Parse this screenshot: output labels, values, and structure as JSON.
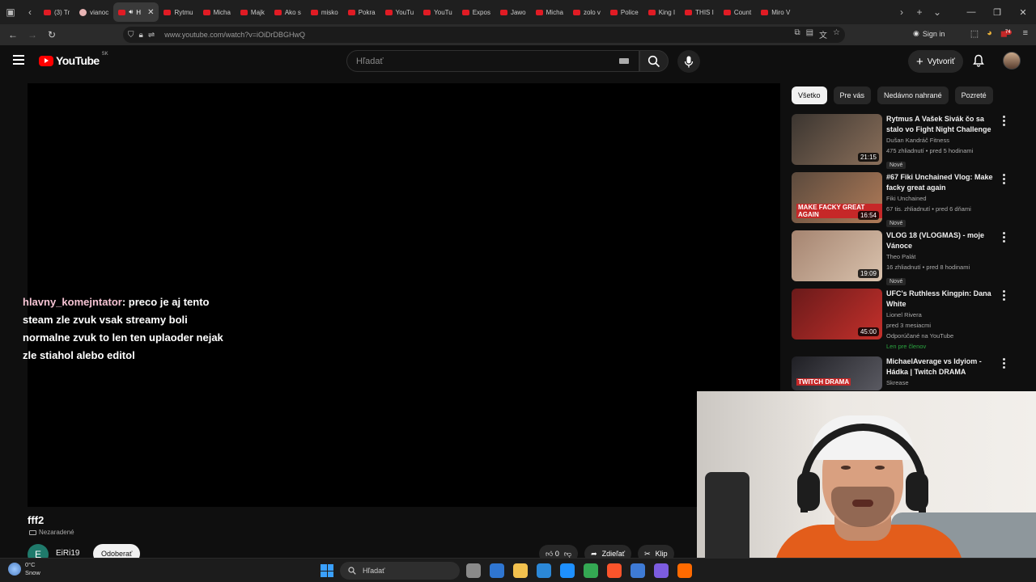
{
  "browser": {
    "tabs": [
      {
        "label": "(3) Tr",
        "color": "#e01b24"
      },
      {
        "label": "vianoc",
        "color": "#e7b3b3"
      },
      {
        "label": "H",
        "color": "#e01b24",
        "active": true
      },
      {
        "label": "Rytmu",
        "color": "#e01b24"
      },
      {
        "label": "Micha",
        "color": "#e01b24"
      },
      {
        "label": "Majk",
        "color": "#e01b24"
      },
      {
        "label": "Ako s",
        "color": "#e01b24"
      },
      {
        "label": "misko",
        "color": "#e01b24"
      },
      {
        "label": "Pokra",
        "color": "#e01b24"
      },
      {
        "label": "YouTu",
        "color": "#e01b24"
      },
      {
        "label": "YouTu",
        "color": "#e01b24"
      },
      {
        "label": "Expos",
        "color": "#e01b24"
      },
      {
        "label": "Jawo",
        "color": "#e01b24"
      },
      {
        "label": "Micha",
        "color": "#e01b24"
      },
      {
        "label": "zolo v",
        "color": "#e01b24"
      },
      {
        "label": "Police",
        "color": "#e01b24"
      },
      {
        "label": "King I",
        "color": "#e01b24"
      },
      {
        "label": "THIS I",
        "color": "#e01b24"
      },
      {
        "label": "Count",
        "color": "#e01b24"
      },
      {
        "label": "Miro V",
        "color": "#e01b24"
      }
    ],
    "url": "www.youtube.com/watch?v=iOiDrDBGHwQ",
    "sign_in": "Sign in",
    "ext_badge": "74"
  },
  "youtube": {
    "logo_text": "YouTube",
    "country_code": "SK",
    "search_placeholder": "Hľadať",
    "create_label": "Vytvoriť",
    "colors": {
      "brand": "#ff0000",
      "background": "#0f0f0f"
    }
  },
  "player": {
    "chat_user": "hlavny_komejntator",
    "chat_message": ": preco je aj tento steam zle zvuk vsak streamy boli normalne zvuk to len ten uplaoder nejak zle stiahol alebo editol"
  },
  "video": {
    "title": "fff2",
    "label": "Nezaradené",
    "channel_initial": "E",
    "channel_name": "EiRi19",
    "subscribe_label": "Odoberať",
    "like_count": "0",
    "share_label": "Zdieľať",
    "clip_label": "Klip"
  },
  "chips": [
    "Všetko",
    "Pre vás",
    "Nedávno nahrané",
    "Pozreté"
  ],
  "recommendations": [
    {
      "title": "Rytmus A Vašek Sivák čo sa stalo vo Fight Night Challenge",
      "channel": "Dušan Kandráč Fitness",
      "stats": "475 zhliadnutí • pred 5 hodinami",
      "badge": "Nové",
      "duration": "21:15",
      "thumb_colors": [
        "#3b3530",
        "#8a6f5a"
      ]
    },
    {
      "title": "#67 Fiki Unchained Vlog: Make facky great again",
      "channel": "Fiki Unchained",
      "stats": "67 tis. zhliadnutí • pred 6 dňami",
      "badge": "Nové",
      "duration": "16:54",
      "thumb_caption": "MAKE FACKY GREAT AGAIN",
      "thumb_colors": [
        "#5b4a3d",
        "#b07b58"
      ]
    },
    {
      "title": "VLOG 18 (VLOGMAS) - moje Vánoce",
      "channel": "Theo Palát",
      "stats": "16 zhliadnutí • pred 8 hodinami",
      "badge": "Nové",
      "duration": "19:09",
      "thumb_colors": [
        "#a58470",
        "#d9c2ad"
      ]
    },
    {
      "title": "UFC's Ruthless Kingpin: Dana White",
      "channel": "Lionel Rivera",
      "stats": "pred 3 mesiacmi",
      "extra": "Odporúčané na YouTube",
      "member": "Len pre členov",
      "duration": "45:00",
      "thumb_colors": [
        "#6a1a1a",
        "#c4302b"
      ]
    },
    {
      "title": "MichaelAverage vs Idyiom - Hádka | Twitch DRAMA",
      "channel": "Skrease",
      "duration": "",
      "thumb_caption": "TWITCH DRAMA",
      "thumb_colors": [
        "#1f1f24",
        "#5a5a62"
      ]
    }
  ],
  "taskbar": {
    "temperature": "0°C",
    "condition": "Snow",
    "search_label": "Hľadať",
    "app_colors": [
      "#8a8a8a",
      "#2f76d2",
      "#f2c14e",
      "#2b88d8",
      "#1e90ff",
      "#34a853",
      "#fb542b",
      "#3e7bd6",
      "#7c5ce0",
      "#ff6a00"
    ]
  }
}
